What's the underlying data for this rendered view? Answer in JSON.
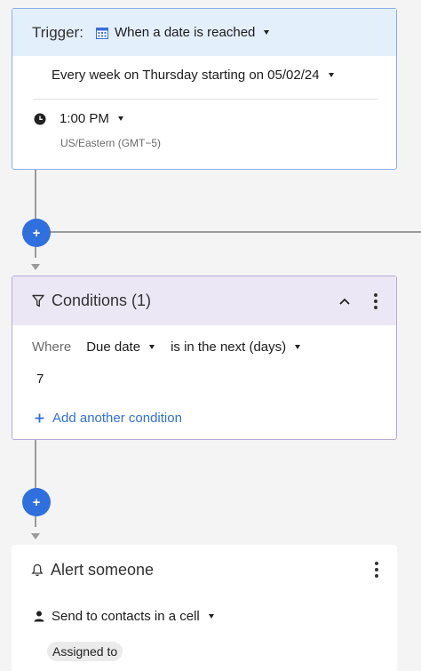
{
  "trigger": {
    "label": "Trigger:",
    "type_value": "When a date is reached",
    "schedule": "Every week on Thursday starting on 05/02/24",
    "time": "1:00 PM",
    "timezone": "US/Eastern (GMT−5)"
  },
  "conditions": {
    "title": "Conditions (1)",
    "where_label": "Where",
    "field": "Due date",
    "operator": "is in the next (days)",
    "value": "7",
    "add_link": "Add another condition"
  },
  "alert": {
    "title": "Alert someone",
    "recipient_mode": "Send to contacts in a cell",
    "column_chip": "Assigned to"
  },
  "plus_label": "+",
  "colors": {
    "accent": "#2f6fde",
    "trigger_header": "#e3effb",
    "conditions_header": "#ece7f5"
  }
}
